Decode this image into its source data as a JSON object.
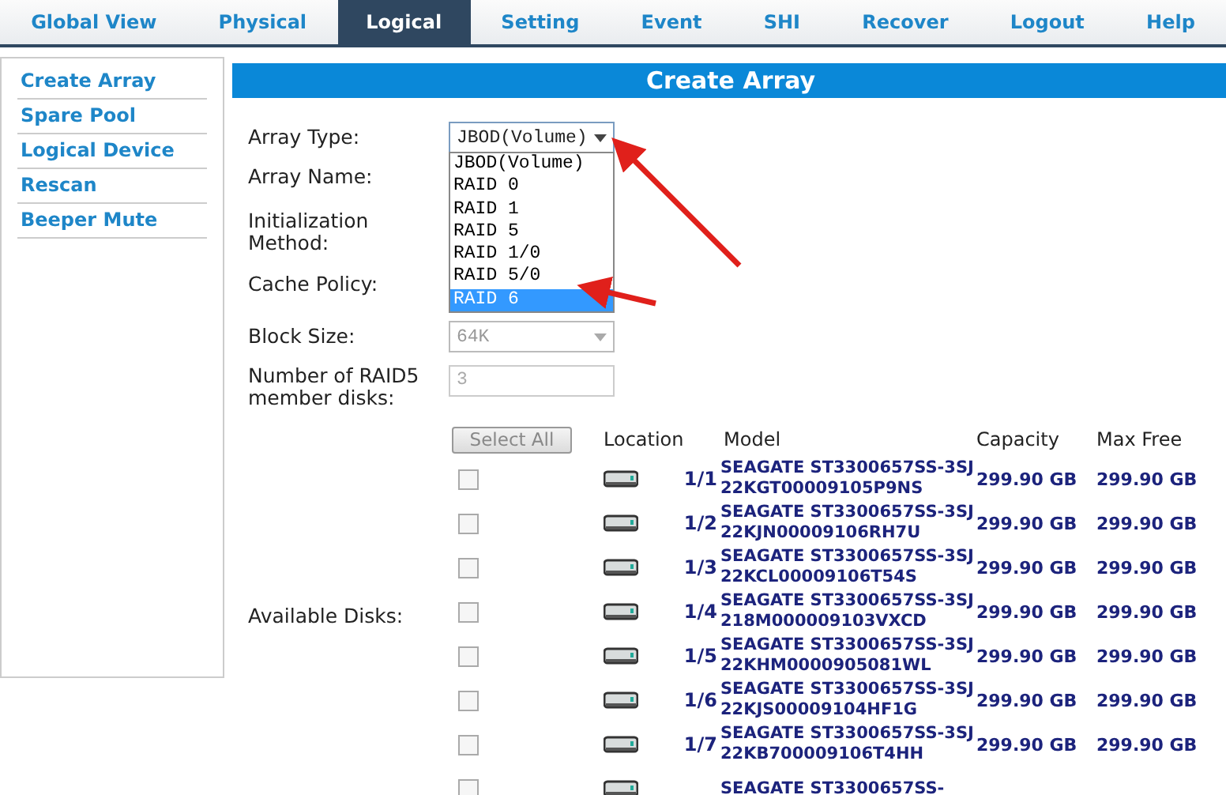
{
  "nav_tabs": [
    {
      "label": "Global View",
      "selected": false
    },
    {
      "label": "Physical",
      "selected": false
    },
    {
      "label": "Logical",
      "selected": true
    },
    {
      "label": "Setting",
      "selected": false
    },
    {
      "label": "Event",
      "selected": false
    },
    {
      "label": "SHI",
      "selected": false
    },
    {
      "label": "Recover",
      "selected": false
    },
    {
      "label": "Logout",
      "selected": false
    },
    {
      "label": "Help",
      "selected": false
    }
  ],
  "sidebar": {
    "items": [
      "Create Array",
      "Spare Pool",
      "Logical Device",
      "Rescan",
      "Beeper Mute"
    ]
  },
  "panel_title": "Create Array",
  "form": {
    "array_type": {
      "label": "Array Type:",
      "value": "JBOD(Volume)",
      "expanded": true,
      "options": [
        {
          "label": "JBOD(Volume)",
          "highlighted": false
        },
        {
          "label": "RAID 0",
          "highlighted": false
        },
        {
          "label": "RAID 1",
          "highlighted": false
        },
        {
          "label": "RAID 5",
          "highlighted": false
        },
        {
          "label": "RAID 1/0",
          "highlighted": false
        },
        {
          "label": "RAID 5/0",
          "highlighted": false
        },
        {
          "label": "RAID 6",
          "highlighted": true
        }
      ]
    },
    "array_name": {
      "label": "Array Name:"
    },
    "initialization_method": {
      "label": "Initialization Method:"
    },
    "cache_policy": {
      "label": "Cache Policy:"
    },
    "block_size": {
      "label": "Block Size:",
      "value": "64K",
      "disabled": true
    },
    "member_disks": {
      "label": "Number of RAID5 member disks:",
      "value": "3",
      "disabled": true
    },
    "available_disks": {
      "label": "Available Disks:",
      "select_all": {
        "label": "Select All",
        "disabled": true
      },
      "columns": [
        "Location",
        "Model",
        "Capacity",
        "Max Free"
      ],
      "rows": [
        {
          "checked": false,
          "location": "1/1",
          "model": "SEAGATE ST3300657SS-3SJ22KGT00009105P9NS",
          "capacity": "299.90 GB",
          "max_free": "299.90 GB"
        },
        {
          "checked": false,
          "location": "1/2",
          "model": "SEAGATE ST3300657SS-3SJ22KJN00009106RH7U",
          "capacity": "299.90 GB",
          "max_free": "299.90 GB"
        },
        {
          "checked": false,
          "location": "1/3",
          "model": "SEAGATE ST3300657SS-3SJ22KCL00009106T54S",
          "capacity": "299.90 GB",
          "max_free": "299.90 GB"
        },
        {
          "checked": false,
          "location": "1/4",
          "model": "SEAGATE ST3300657SS-3SJ218M000009103VXCD",
          "capacity": "299.90 GB",
          "max_free": "299.90 GB"
        },
        {
          "checked": false,
          "location": "1/5",
          "model": "SEAGATE ST3300657SS-3SJ22KHM0000905081WL",
          "capacity": "299.90 GB",
          "max_free": "299.90 GB"
        },
        {
          "checked": false,
          "location": "1/6",
          "model": "SEAGATE ST3300657SS-3SJ22KJS00009104HF1G",
          "capacity": "299.90 GB",
          "max_free": "299.90 GB"
        },
        {
          "checked": false,
          "location": "1/7",
          "model": "SEAGATE ST3300657SS-3SJ22KB700009106T4HH",
          "capacity": "299.90 GB",
          "max_free": "299.90 GB"
        },
        {
          "checked": false,
          "model": "SEAGATE ST3300657SS-"
        }
      ]
    }
  }
}
